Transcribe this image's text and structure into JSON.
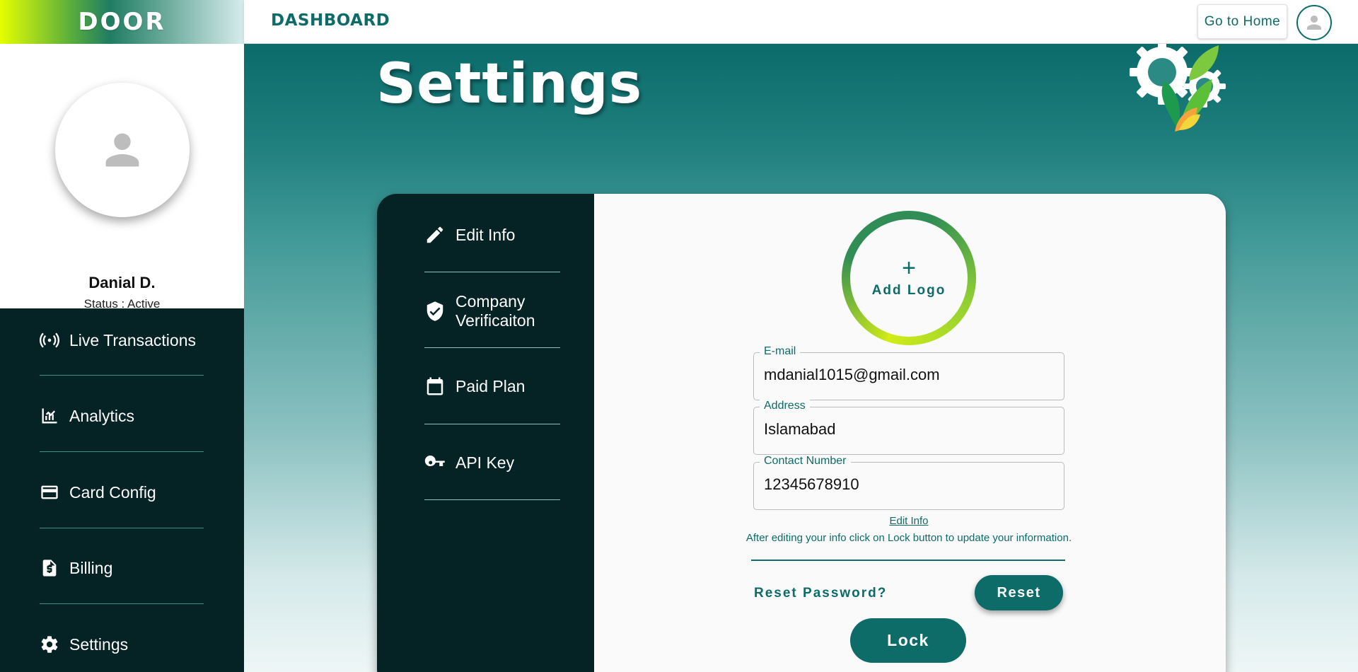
{
  "brand": {
    "name": "DOOR"
  },
  "topbar": {
    "title": "DASHBOARD",
    "home_label": "Go to Home"
  },
  "profile": {
    "name": "Danial D.",
    "status": "Status : Active"
  },
  "sidebar": {
    "items": [
      {
        "label": "Live Transactions",
        "icon": "broadcast-icon"
      },
      {
        "label": "Analytics",
        "icon": "analytics-icon"
      },
      {
        "label": "Card Config",
        "icon": "credit-card-icon"
      },
      {
        "label": "Billing",
        "icon": "billing-document-icon"
      },
      {
        "label": "Settings",
        "icon": "gear-icon"
      }
    ]
  },
  "page": {
    "title": "Settings"
  },
  "settings_nav": {
    "items": [
      {
        "label": "Edit Info",
        "icon": "pencil-icon"
      },
      {
        "label": "Company Verificaiton",
        "icon": "shield-check-icon"
      },
      {
        "label": "Paid Plan",
        "icon": "calendar-icon"
      },
      {
        "label": "API Key",
        "icon": "key-icon"
      }
    ]
  },
  "logo": {
    "plus": "+",
    "label": "Add Logo"
  },
  "form": {
    "email": {
      "label": "E-mail",
      "value": "mdanial1015@gmail.com"
    },
    "address": {
      "label": "Address",
      "value": "Islamabad"
    },
    "contact": {
      "label": "Contact Number",
      "value": "12345678910"
    }
  },
  "actions": {
    "edit_link": "Edit Info",
    "edit_note": "After editing your info click on Lock button to update your information.",
    "reset_question": "Reset Password?",
    "reset_label": "Reset",
    "lock_label": "Lock"
  },
  "colors": {
    "accent": "#0d6b68",
    "sidebar_dark": "#052225",
    "brand_yellow": "#e6ff00"
  }
}
